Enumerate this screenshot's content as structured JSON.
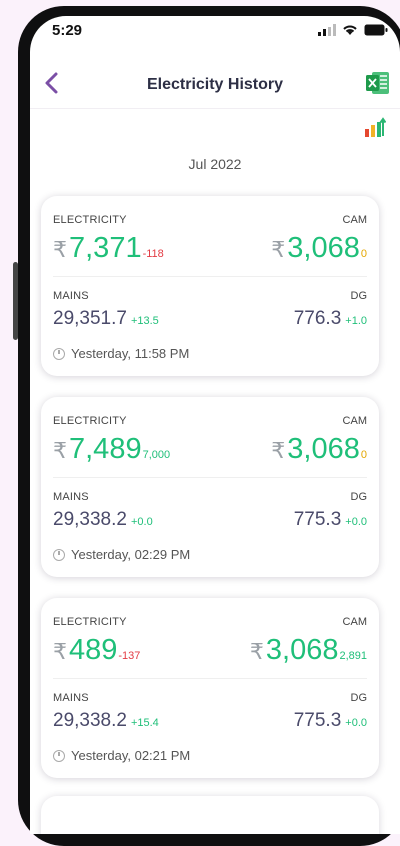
{
  "status": {
    "time": "5:29"
  },
  "header": {
    "title": "Electricity History"
  },
  "month": "Jul 2022",
  "cards": [
    {
      "electricity_label": "ELECTRICITY",
      "cam_label": "CAM",
      "currency": "₹",
      "electricity_value": "7,371",
      "electricity_change": "-118",
      "cam_value": "3,068",
      "cam_change": "0",
      "mains_label": "MAINS",
      "dg_label": "DG",
      "mains_value": "29,351.7",
      "mains_change": "+13.5",
      "dg_value": "776.3",
      "dg_change": "+1.0",
      "timestamp": "Yesterday, 11:58 PM"
    },
    {
      "electricity_label": "ELECTRICITY",
      "cam_label": "CAM",
      "currency": "₹",
      "electricity_value": "7,489",
      "electricity_change": "7,000",
      "cam_value": "3,068",
      "cam_change": "0",
      "mains_label": "MAINS",
      "dg_label": "DG",
      "mains_value": "29,338.2",
      "mains_change": "+0.0",
      "dg_value": "775.3",
      "dg_change": "+0.0",
      "timestamp": "Yesterday, 02:29 PM"
    },
    {
      "electricity_label": "ELECTRICITY",
      "cam_label": "CAM",
      "currency": "₹",
      "electricity_value": "489",
      "electricity_change": "-137",
      "cam_value": "3,068",
      "cam_change": "2,891",
      "mains_label": "MAINS",
      "dg_label": "DG",
      "mains_value": "29,338.2",
      "mains_change": "+15.4",
      "dg_value": "775.3",
      "dg_change": "+0.0",
      "timestamp": "Yesterday, 02:21 PM"
    }
  ],
  "colors": {
    "accent": "#7b4fa6",
    "positive": "#1fbf79",
    "negative": "#e23b43",
    "neutral_change": "#e4a700",
    "excel_green": "#1e9a4b"
  },
  "icons": {
    "back": "chevron-left-icon",
    "export": "excel-icon",
    "chart": "bar-chart-icon",
    "time": "clock-icon"
  }
}
